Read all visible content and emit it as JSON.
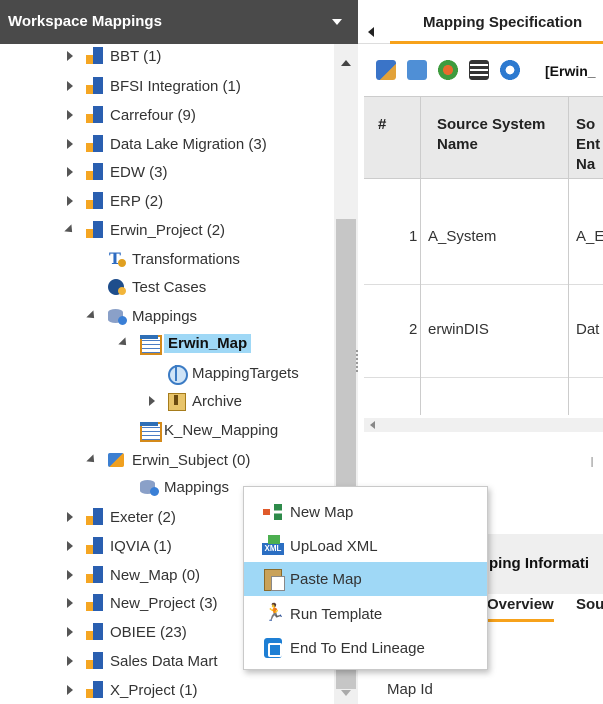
{
  "left_panel": {
    "title": "Workspace Mappings",
    "tree": [
      {
        "label": "BBT (1)",
        "icon": "project-icon",
        "toggle": "closed"
      },
      {
        "label": "BFSI Integration (1)",
        "icon": "project-icon",
        "toggle": "closed"
      },
      {
        "label": "Carrefour (9)",
        "icon": "project-icon",
        "toggle": "closed"
      },
      {
        "label": "Data Lake Migration (3)",
        "icon": "project-icon",
        "toggle": "closed"
      },
      {
        "label": "EDW (3)",
        "icon": "project-icon",
        "toggle": "closed"
      },
      {
        "label": "ERP (2)",
        "icon": "project-icon",
        "toggle": "closed"
      },
      {
        "label": "Erwin_Project (2)",
        "icon": "project-icon",
        "toggle": "open"
      },
      {
        "label": "Transformations",
        "icon": "transformations-icon",
        "toggle": "none"
      },
      {
        "label": "Test Cases",
        "icon": "test-cases-icon",
        "toggle": "none"
      },
      {
        "label": "Mappings",
        "icon": "mappings-icon",
        "toggle": "open"
      },
      {
        "label": "Erwin_Map",
        "icon": "map-icon",
        "toggle": "open",
        "selected": true
      },
      {
        "label": "MappingTargets",
        "icon": "target-icon",
        "toggle": "none"
      },
      {
        "label": "Archive",
        "icon": "archive-icon",
        "toggle": "closed"
      },
      {
        "label": "K_New_Mapping",
        "icon": "map-icon",
        "toggle": "none"
      },
      {
        "label": "Erwin_Subject (0)",
        "icon": "subject-icon",
        "toggle": "open"
      },
      {
        "label": "Mappings",
        "icon": "mappings-icon",
        "toggle": "none"
      },
      {
        "label": "Exeter (2)",
        "icon": "project-icon",
        "toggle": "closed"
      },
      {
        "label": "IQVIA (1)",
        "icon": "project-icon",
        "toggle": "closed"
      },
      {
        "label": "New_Map (0)",
        "icon": "project-icon",
        "toggle": "closed"
      },
      {
        "label": "New_Project (3)",
        "icon": "project-icon",
        "toggle": "closed"
      },
      {
        "label": "OBIEE (23)",
        "icon": "project-icon",
        "toggle": "closed"
      },
      {
        "label": "Sales Data Mart",
        "icon": "project-icon",
        "toggle": "closed"
      },
      {
        "label": "X_Project (1)",
        "icon": "project-icon",
        "toggle": "closed"
      }
    ]
  },
  "right_panel": {
    "tab_label": "Mapping Specification",
    "toolbar_label": "[Erwin_",
    "grid": {
      "headers": [
        "#",
        "Source System Name",
        "So Ent Na"
      ],
      "rows": [
        {
          "num": "1",
          "system": "A_System",
          "entity": "A_E"
        },
        {
          "num": "2",
          "system": "erwinDIS",
          "entity": "Dat"
        }
      ]
    },
    "pager_text": "I",
    "info_title": "ping Informati",
    "subtabs": [
      "Overview",
      "Sou"
    ],
    "map_id_label": "Map Id"
  },
  "context_menu": {
    "items": [
      {
        "label": "New Map",
        "icon": "new-map-icon"
      },
      {
        "label": "UpLoad XML",
        "icon": "upload-xml-icon"
      },
      {
        "label": "Paste Map",
        "icon": "paste-map-icon",
        "highlighted": true
      },
      {
        "label": "Run Template",
        "icon": "run-template-icon"
      },
      {
        "label": "End To End Lineage",
        "icon": "lineage-icon"
      }
    ]
  },
  "colors": {
    "header_bg": "#4a4a4a",
    "selection": "#9fd8f6",
    "accent": "#f7a21b"
  }
}
